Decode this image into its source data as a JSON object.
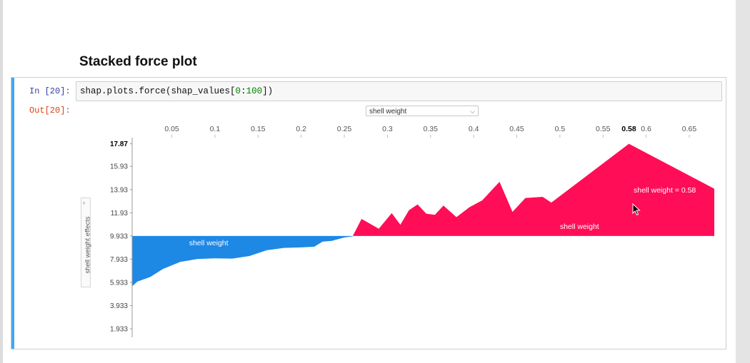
{
  "section_title": "Stacked force plot",
  "cell": {
    "in_prompt": "In [20]:",
    "code_prefix": "shap.plots.force(shap_values[",
    "code_num_a": "0",
    "code_colon": ":",
    "code_num_b": "100",
    "code_suffix": "])",
    "out_prompt": "Out[20]:"
  },
  "dropdown": {
    "selected": "shell weight"
  },
  "y_axis_label": "shell weight effects",
  "colors": {
    "positive": "#ff0d57",
    "negative": "#1e88e5",
    "cell_accent": "#42a5f5"
  },
  "chart_data": {
    "type": "area",
    "x_ticks": [
      "0.05",
      "0.1",
      "0.15",
      "0.2",
      "0.25",
      "0.3",
      "0.35",
      "0.4",
      "0.45",
      "0.5",
      "0.55",
      "0.6",
      "0.65"
    ],
    "x_tick_values": [
      0.05,
      0.1,
      0.15,
      0.2,
      0.25,
      0.3,
      0.35,
      0.4,
      0.45,
      0.5,
      0.55,
      0.6,
      0.65
    ],
    "x_highlight_label": "0.58",
    "x_highlight_value": 0.58,
    "xlim": [
      0.004,
      0.679
    ],
    "y_ticks": [
      "17.87",
      "15.93",
      "13.93",
      "11.93",
      "9.933",
      "7.933",
      "5.933",
      "3.933",
      "1.933"
    ],
    "y_tick_values": [
      17.87,
      15.93,
      13.93,
      11.93,
      9.933,
      7.933,
      5.933,
      3.933,
      1.933
    ],
    "ylim": [
      1.2,
      18.4
    ],
    "base_value": 9.933,
    "series": [
      {
        "label": "shell weight",
        "sign": "negative",
        "points": [
          [
            0.004,
            5.6
          ],
          [
            0.01,
            6.0
          ],
          [
            0.025,
            6.4
          ],
          [
            0.04,
            7.1
          ],
          [
            0.06,
            7.7
          ],
          [
            0.08,
            7.95
          ],
          [
            0.1,
            8.0
          ],
          [
            0.12,
            7.98
          ],
          [
            0.14,
            8.2
          ],
          [
            0.16,
            8.7
          ],
          [
            0.18,
            8.9
          ],
          [
            0.2,
            8.95
          ],
          [
            0.215,
            9.0
          ],
          [
            0.225,
            9.45
          ],
          [
            0.235,
            9.5
          ],
          [
            0.245,
            9.7
          ],
          [
            0.25,
            9.8
          ],
          [
            0.26,
            9.9
          ]
        ]
      },
      {
        "label": "shell weight",
        "sign": "positive",
        "points": [
          [
            0.26,
            9.95
          ],
          [
            0.27,
            11.4
          ],
          [
            0.29,
            10.55
          ],
          [
            0.305,
            11.9
          ],
          [
            0.315,
            10.9
          ],
          [
            0.325,
            12.15
          ],
          [
            0.335,
            12.65
          ],
          [
            0.345,
            11.85
          ],
          [
            0.355,
            11.75
          ],
          [
            0.365,
            12.55
          ],
          [
            0.38,
            11.55
          ],
          [
            0.395,
            12.4
          ],
          [
            0.41,
            13.0
          ],
          [
            0.43,
            14.6
          ],
          [
            0.445,
            12.0
          ],
          [
            0.46,
            13.2
          ],
          [
            0.48,
            13.3
          ],
          [
            0.49,
            12.8
          ],
          [
            0.58,
            17.87
          ],
          [
            0.679,
            14.0
          ]
        ]
      }
    ],
    "hover_label": "shell weight = 0.58"
  }
}
